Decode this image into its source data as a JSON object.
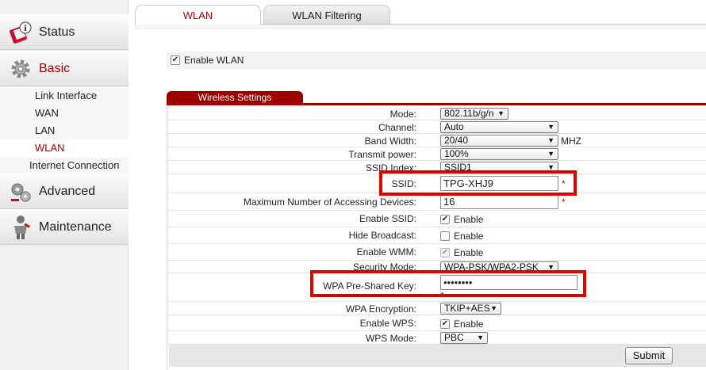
{
  "sidebar": {
    "status": {
      "label": "Status",
      "icon": "status-info-icon"
    },
    "basic": {
      "label": "Basic",
      "icon": "gear-icon"
    },
    "sub_items": [
      "Link Interface",
      "WAN",
      "LAN",
      "WLAN",
      "Internet Connection"
    ],
    "active_sub_item": "WLAN",
    "advanced": {
      "label": "Advanced",
      "icon": "advanced-tools-icon"
    },
    "maintenance": {
      "label": "Maintenance",
      "icon": "maintenance-person-icon"
    }
  },
  "tabs": [
    {
      "label": "WLAN",
      "active": true
    },
    {
      "label": "WLAN Filtering",
      "active": false
    }
  ],
  "enable_wlan": {
    "label": "Enable WLAN",
    "checked": true
  },
  "section": {
    "title": "Wireless Settings"
  },
  "settings": {
    "mode": {
      "label": "Mode:",
      "value": "802.11b/g/n"
    },
    "channel": {
      "label": "Channel:",
      "value": "Auto"
    },
    "band_width": {
      "label": "Band Width:",
      "value": "20/40",
      "unit": "MHZ"
    },
    "transmit_power": {
      "label": "Transmit power:",
      "value": "100%"
    },
    "ssid_index": {
      "label": "SSID Index:",
      "value": "SSID1"
    },
    "ssid": {
      "label": "SSID:",
      "value": "TPG-XHJ9",
      "required_mark": "*"
    },
    "max_devices": {
      "label": "Maximum Number of Accessing Devices:",
      "value": "16",
      "required_mark": "*"
    },
    "enable_ssid": {
      "label": "Enable SSID:",
      "option": "Enable",
      "checked": true
    },
    "hide_broadcast": {
      "label": "Hide Broadcast:",
      "option": "Enable",
      "checked": false
    },
    "enable_wmm": {
      "label": "Enable WMM:",
      "option": "Enable",
      "checked": true,
      "disabled": true
    },
    "security_mode": {
      "label": "Security Mode:",
      "value": "WPA-PSK/WPA2-PSK"
    },
    "wpa_key": {
      "label": "WPA Pre-Shared Key:",
      "value": "••••••••",
      "required_mark": "*"
    },
    "wpa_encryption": {
      "label": "WPA Encryption:",
      "value": "TKIP+AES"
    },
    "enable_wps": {
      "label": "Enable WPS:",
      "option": "Enable",
      "checked": true
    },
    "wps_mode": {
      "label": "WPS Mode:",
      "value": "PBC"
    }
  },
  "submit_label": "Submit",
  "colors": {
    "accent": "#a00000",
    "highlight": "#e00000"
  }
}
